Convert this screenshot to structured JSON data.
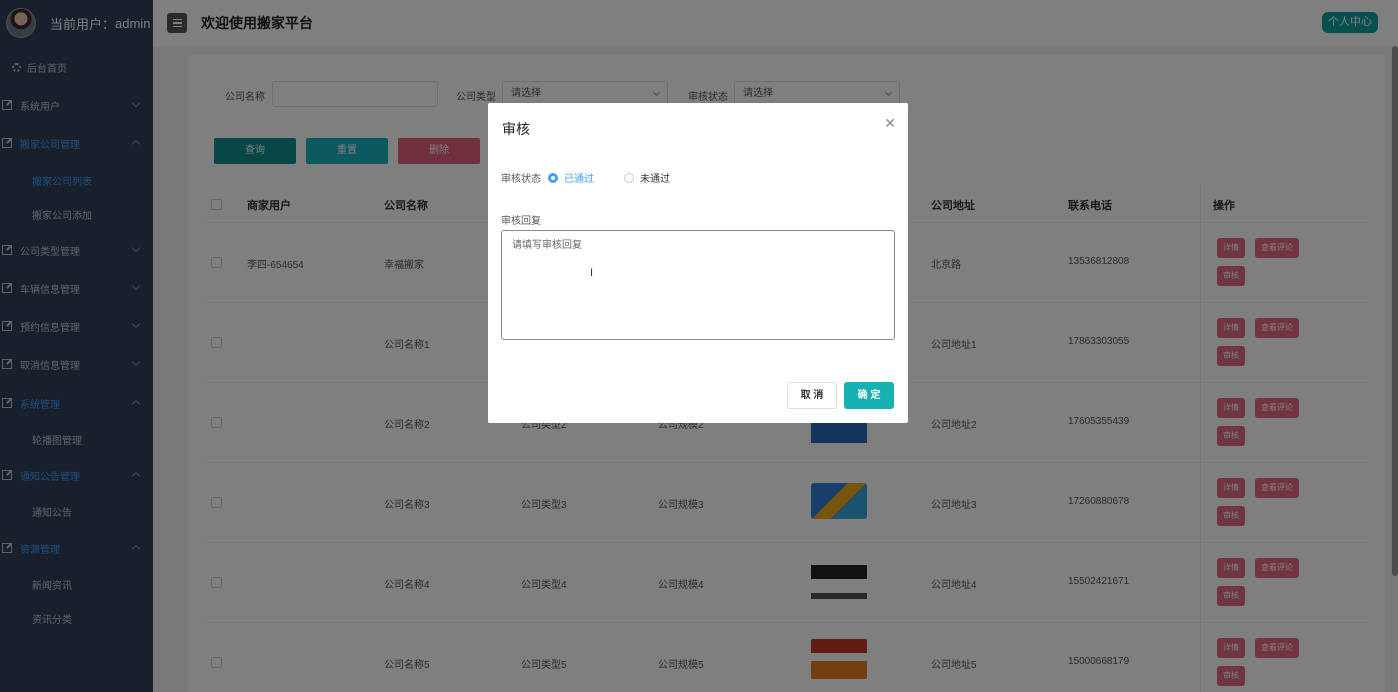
{
  "header": {
    "current_user_label": "当前用户：",
    "username": "admin",
    "title": "欢迎使用搬家平台",
    "profile_button": "个人中心"
  },
  "sidebar": {
    "home": "后台首页",
    "items": [
      {
        "label": "系统用户"
      },
      {
        "label": "搬家公司管理"
      },
      {
        "label": "搬家公司列表"
      },
      {
        "label": "搬家公司添加"
      },
      {
        "label": "公司类型管理"
      },
      {
        "label": "车辆信息管理"
      },
      {
        "label": "预约信息管理"
      },
      {
        "label": "取消信息管理"
      },
      {
        "label": "系统管理"
      },
      {
        "label": "轮播图管理"
      },
      {
        "label": "通知公告管理"
      },
      {
        "label": "通知公告"
      },
      {
        "label": "资源管理"
      },
      {
        "label": "新闻资讯"
      },
      {
        "label": "资讯分类"
      }
    ]
  },
  "filters": {
    "company_name_label": "公司名称",
    "company_type_label": "公司类型",
    "company_type_value": "请选择",
    "audit_status_label": "审核状态",
    "audit_status_value": "请选择"
  },
  "buttons": {
    "query": "查询",
    "reset": "重置",
    "delete": "删除"
  },
  "table": {
    "headers": [
      "商家用户",
      "公司名称",
      "公司地址",
      "联系电话",
      "操作"
    ],
    "rows": [
      {
        "user": "李四-654654",
        "name": "幸福搬家",
        "type": "",
        "scale": "",
        "address": "北京路",
        "phone": "13536812808"
      },
      {
        "user": "",
        "name": "公司名称1",
        "type": "",
        "scale": "",
        "address": "公司地址1",
        "phone": "17863303055"
      },
      {
        "user": "",
        "name": "公司名称2",
        "type": "公司类型2",
        "scale": "公司规模2",
        "address": "公司地址2",
        "phone": "17605355439"
      },
      {
        "user": "",
        "name": "公司名称3",
        "type": "公司类型3",
        "scale": "公司规模3",
        "address": "公司地址3",
        "phone": "17260880678"
      },
      {
        "user": "",
        "name": "公司名称4",
        "type": "公司类型4",
        "scale": "公司规模4",
        "address": "公司地址4",
        "phone": "15502421671"
      },
      {
        "user": "",
        "name": "公司名称5",
        "type": "公司类型5",
        "scale": "公司规模5",
        "address": "公司地址5",
        "phone": "15000668179"
      }
    ],
    "op_detail": "详情",
    "op_comments": "查看评论",
    "op_audit": "审核"
  },
  "dialog": {
    "title": "审核",
    "status_label": "审核状态",
    "option_pass": "已通过",
    "option_fail": "未通过",
    "reply_label": "审核回复",
    "reply_placeholder": "请填写审核回复",
    "cancel": "取 消",
    "confirm": "确 定"
  },
  "colors": {
    "sidebar_bg": "#304156",
    "accent_blue": "#409eff",
    "teal": "#10a0a0",
    "danger_pink": "#e06a80"
  }
}
